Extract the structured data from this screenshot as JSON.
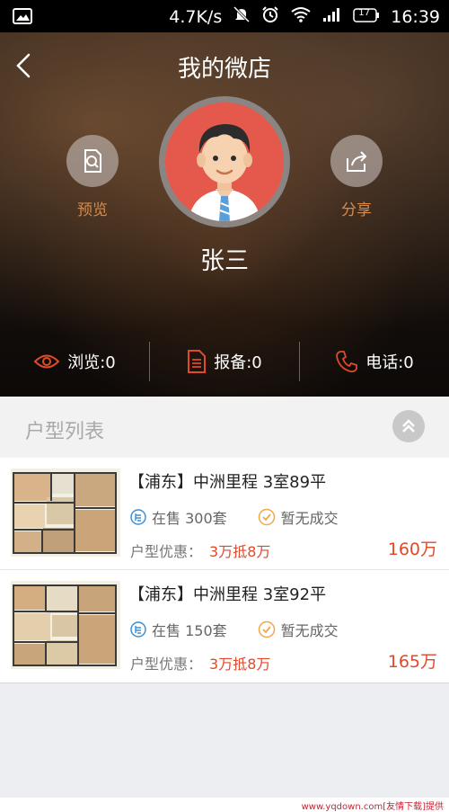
{
  "status_bar": {
    "speed": "4.7K/s",
    "battery": "17",
    "time": "16:39",
    "icons": [
      "image-icon",
      "mute-icon",
      "alarm-icon",
      "wifi-icon",
      "signal-icon",
      "battery-icon"
    ]
  },
  "header": {
    "title": "我的微店",
    "back_icon": "chevron-left-icon"
  },
  "profile": {
    "name": "张三",
    "preview_label": "预览",
    "share_label": "分享"
  },
  "stats": [
    {
      "label": "浏览:0",
      "icon": "eye-icon"
    },
    {
      "label": "报备:0",
      "icon": "document-icon"
    },
    {
      "label": "电话:0",
      "icon": "phone-icon"
    }
  ],
  "section": {
    "title": "户型列表"
  },
  "listings": [
    {
      "title": "【浦东】中洲里程 3室89平",
      "on_sale": "在售 300套",
      "deal": "暂无成交",
      "promo_label": "户型优惠：",
      "promo_value": "3万抵8万",
      "price": "160万"
    },
    {
      "title": "【浦东】中洲里程 3室92平",
      "on_sale": "在售 150套",
      "deal": "暂无成交",
      "promo_label": "户型优惠：",
      "promo_value": "3万抵8万",
      "price": "165万"
    }
  ],
  "watermark": "www.yqdown.com[友情下载]提供",
  "colors": {
    "accent": "#e04a2a",
    "orange_label": "#d98a4a",
    "avatar_bg": "#e5594d"
  }
}
